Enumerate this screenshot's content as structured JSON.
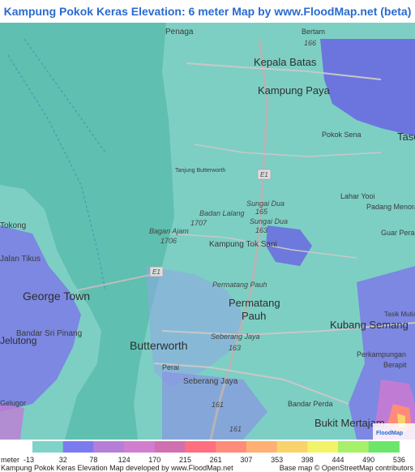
{
  "title": "Kampung Pokok Keras Elevation: 6 meter Map by www.FloodMap.net (beta)",
  "map": {
    "places": [
      {
        "name": "Penaga",
        "size": "small"
      },
      {
        "name": "Bertam",
        "size": "small"
      },
      {
        "name": "Kepala Batas",
        "size": "big"
      },
      {
        "name": "Kampung Paya",
        "size": "big"
      },
      {
        "name": "Pokok Sena",
        "size": "small"
      },
      {
        "name": "Tasek",
        "size": "big"
      },
      {
        "name": "Lahar Yooi",
        "size": "small"
      },
      {
        "name": "Padang Menora",
        "size": "small"
      },
      {
        "name": "Guar Perahu",
        "size": "small"
      },
      {
        "name": "Tokong",
        "size": "small"
      },
      {
        "name": "Jalan Tikus",
        "size": "small"
      },
      {
        "name": "George Town",
        "size": "big"
      },
      {
        "name": "Bandar Sri Pinang",
        "size": "small"
      },
      {
        "name": "Jelutong",
        "size": "big"
      },
      {
        "name": "Gelugor",
        "size": "small"
      },
      {
        "name": "Badan Lalang",
        "size": "small"
      },
      {
        "name": "Bagan Ajam",
        "size": "small"
      },
      {
        "name": "Kampung Tok Sani",
        "size": "small"
      },
      {
        "name": "Permatang Pauh",
        "size": "small"
      },
      {
        "name": "Permatang",
        "size": "big"
      },
      {
        "name": "Pauh",
        "size": "big"
      },
      {
        "name": "Butterworth",
        "size": "big"
      },
      {
        "name": "Perai",
        "size": "small"
      },
      {
        "name": "Seberang Jaya",
        "size": "small"
      },
      {
        "name": "Kubang Semang",
        "size": "big"
      },
      {
        "name": "Perkampungan",
        "size": "small"
      },
      {
        "name": "Berapit",
        "size": "small"
      },
      {
        "name": "Tasik Mutiara",
        "size": "small"
      },
      {
        "name": "Bandar Perda",
        "size": "small"
      },
      {
        "name": "Bukit Mertajam",
        "size": "big"
      },
      {
        "name": "Tanjung Butterworth",
        "size": "tiny"
      }
    ],
    "routes": [
      "166",
      "E1",
      "165",
      "1707",
      "163",
      "1706",
      "E1",
      "163",
      "161",
      "161",
      "Sungai Dua",
      "Sungai Dua",
      "Seberang Jaya"
    ],
    "colors": {
      "sea": "#5fbfb0",
      "land": "#7dcfc4",
      "low": "#7b7be8",
      "mid": "#9c6ad8",
      "high": "#d890c8"
    }
  },
  "legend": {
    "unit_label": "meter",
    "ticks": [
      "-13",
      "32",
      "78",
      "124",
      "170",
      "215",
      "261",
      "307",
      "353",
      "398",
      "444",
      "490",
      "536"
    ],
    "colors": [
      "#7fd3c8",
      "#7b7bf0",
      "#b57fd8",
      "#d07fd0",
      "#d070b0",
      "#ff6f7f",
      "#ff8c7a",
      "#ffb072",
      "#f7d36a",
      "#f3f36a",
      "#a8f06a",
      "#6ce66a"
    ]
  },
  "footer": {
    "left": "Kampung Pokok Keras Elevation Map developed by www.FloodMap.net",
    "right": "Base map © OpenStreetMap contributors"
  },
  "badge": "FloodMap"
}
